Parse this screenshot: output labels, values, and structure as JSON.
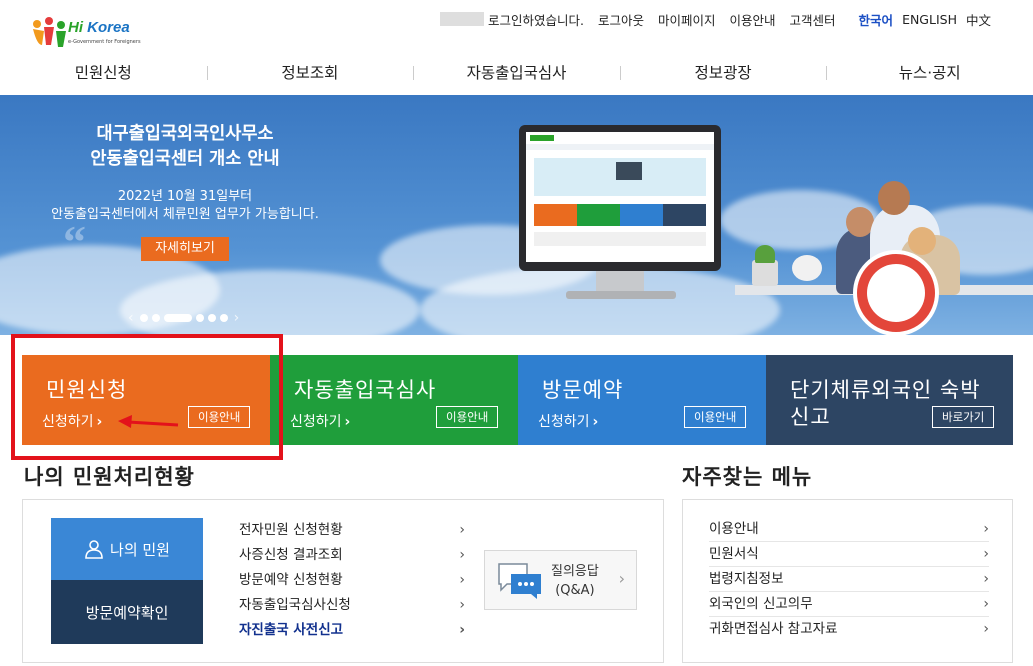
{
  "header": {
    "logo": {
      "brand_hi": "Hi",
      "brand_rest": " Korea",
      "tagline": "e-Government for Foreigners"
    },
    "utility": {
      "login_status": "로그인하였습니다.",
      "links": [
        "로그아웃",
        "마이페이지",
        "이용안내",
        "고객센터"
      ],
      "languages": [
        {
          "label": "한국어",
          "active": true
        },
        {
          "label": "ENGLISH",
          "active": false
        },
        {
          "label": "中文",
          "active": false
        }
      ]
    },
    "gnb": [
      "민원신청",
      "정보조회",
      "자동출입국심사",
      "정보광장",
      "뉴스·공지"
    ]
  },
  "hero": {
    "title_line1": "대구출입국외국인사무소",
    "title_line2": "안동출입국센터 개소 안내",
    "body_line1": "2022년 10월 31일부터",
    "body_line2": "안동출입국센터에서 체류민원 업무가 가능합니다.",
    "button_label": "자세히보기",
    "pager": {
      "total": 6,
      "active_index": 2
    }
  },
  "tiles": [
    {
      "id": "apply",
      "name": "민원신청",
      "action": "신청하기",
      "badge": "이용안내",
      "color": "#ea6b1f"
    },
    {
      "id": "auto-immigration",
      "name": "자동출입국심사",
      "action": "신청하기",
      "badge": "이용안내",
      "color": "#1f9e3b"
    },
    {
      "id": "visit",
      "name": "방문예약",
      "action": "신청하기",
      "badge": "이용안내",
      "color": "#2f7fd0"
    },
    {
      "id": "short-stay",
      "name": "단기체류외국인 숙박 신고",
      "action": "",
      "badge": "바로가기",
      "color": "#2d4563"
    }
  ],
  "status_section": {
    "title": "나의 민원처리현황",
    "my_button": "나의 민원",
    "visit_button": "방문예약확인",
    "items": [
      {
        "label": "전자민원 신청현황",
        "highlight": false
      },
      {
        "label": "사증신청 결과조회",
        "highlight": false
      },
      {
        "label": "방문예약 신청현황",
        "highlight": false
      },
      {
        "label": "자동출입국심사신청",
        "highlight": false
      },
      {
        "label": "자진출국 사전신고",
        "highlight": true
      }
    ],
    "qa": {
      "line1": "질의응답",
      "line2": "(Q&A)"
    }
  },
  "favorites": {
    "title": "자주찾는 메뉴",
    "items": [
      "이용안내",
      "민원서식",
      "법령지침정보",
      "외국인의 신고의무",
      "귀화면접심사 참고자료"
    ]
  },
  "colors": {
    "accent_orange": "#ea6b1f",
    "accent_green": "#1f9e3b",
    "accent_blue": "#2f7fd0",
    "navy": "#2d4563",
    "annotation_red": "#e3121b"
  }
}
